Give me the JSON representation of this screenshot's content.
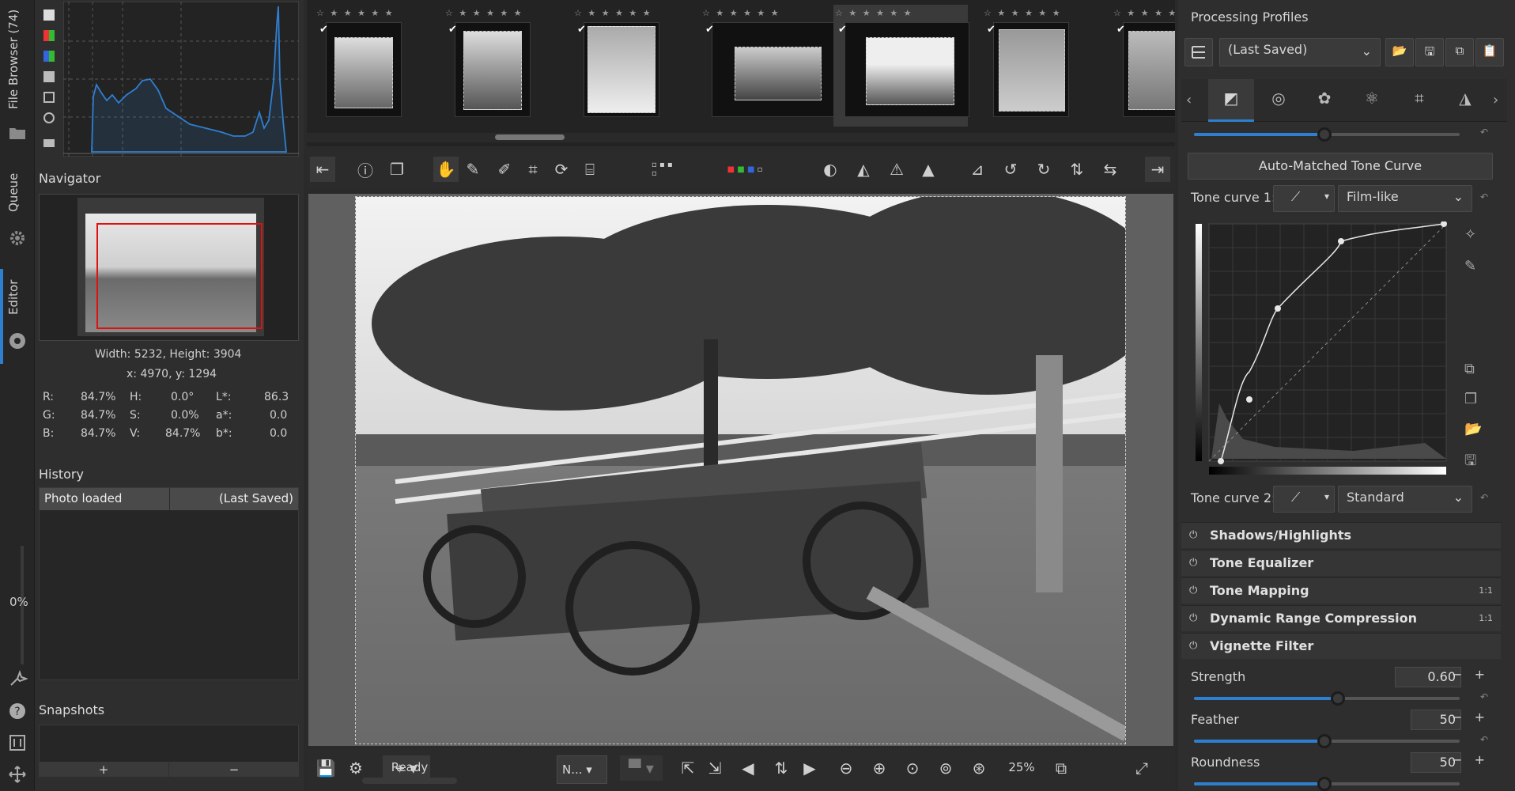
{
  "vtabs": {
    "file_browser": "File Browser (74)",
    "queue": "Queue",
    "editor": "Editor",
    "progress": "0%"
  },
  "navigator": {
    "title": "Navigator",
    "dimensions": "Width: 5232, Height: 3904",
    "coords": "x: 4970, y: 1294",
    "r_label": "R:",
    "r_val": "84.7%",
    "g_label": "G:",
    "g_val": "84.7%",
    "b_label": "B:",
    "b_val": "84.7%",
    "h_label": "H:",
    "h_val": "0.0°",
    "s_label": "S:",
    "s_val": "0.0%",
    "v_label": "V:",
    "v_val": "84.7%",
    "l_label": "L*:",
    "l_val": "86.3",
    "a_label": "a*:",
    "a_val": "0.0",
    "bb_label": "b*:",
    "bb_val": "0.0"
  },
  "history": {
    "title": "History",
    "row_label": "Photo loaded",
    "row_value": "(Last Saved)"
  },
  "snapshots": {
    "title": "Snapshots",
    "add": "+",
    "remove": "−"
  },
  "filmstrip": {
    "stars": "☆ ★ ★ ★ ★ ★"
  },
  "bottombar": {
    "status": "Ready",
    "mode": "N...",
    "zoom": "25%"
  },
  "right": {
    "profiles_title": "Processing Profiles",
    "profile_value": "(Last Saved)",
    "auto_matched": "Auto-Matched Tone Curve",
    "tc1_label": "Tone curve 1:",
    "tc1_value": "Film-like",
    "tc2_label": "Tone curve 2:",
    "tc2_value": "Standard",
    "sections": [
      {
        "title": "Shadows/Highlights",
        "badge": ""
      },
      {
        "title": "Tone Equalizer",
        "badge": ""
      },
      {
        "title": "Tone Mapping",
        "badge": "1:1"
      },
      {
        "title": "Dynamic Range Compression",
        "badge": "1:1"
      },
      {
        "title": "Vignette Filter",
        "badge": ""
      }
    ],
    "strength_label": "Strength",
    "strength_value": "0.60",
    "feather_label": "Feather",
    "feather_value": "50",
    "roundness_label": "Roundness",
    "roundness_value": "50"
  },
  "colors": {
    "accent": "#2f7fd0",
    "nav_box": "#e01010"
  }
}
